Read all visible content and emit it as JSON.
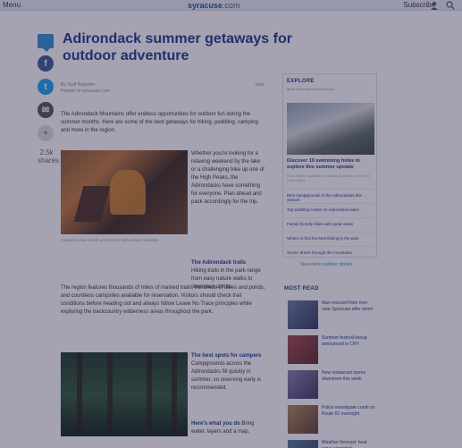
{
  "topbar": {
    "left": "Menu",
    "brand": "syracuse",
    "brand_suffix": ".com",
    "right": "Subscribe"
  },
  "share": {
    "count": "2.5k",
    "count_label": "shares"
  },
  "article": {
    "headline": "Adirondack summer getaways for outdoor adventure",
    "byline": "By Staff Reporter",
    "byline_sub": "Posted on syracuse.com",
    "date": "June",
    "lede": "The Adirondack Mountains offer endless opportunities for outdoor fun during the summer months. Here are some of the best getaways for hiking, paddling, camping and more in the region.",
    "caption1": "Campers relax inside a tent at an Adirondack campsite.",
    "side1": "Whether you're looking for a relaxing weekend by the lake or a challenging hike up one of the High Peaks, the Adirondacks have something for everyone. Plan ahead and pack accordingly for the trip.",
    "head_a": "The Adirondack trails",
    "side2": "Hiking trails in the park range from easy nature walks to strenuous climbs.",
    "full1": "The region features thousands of miles of marked trails, hundreds of lakes and ponds, and countless campsites available for reservation. Visitors should check trail conditions before heading out and always follow Leave No Trace principles while exploring the backcountry wilderness areas throughout the park.",
    "head_b": "The best spots for campers",
    "side3": "Campgrounds across the Adirondacks fill quickly in summer, so reserving early is recommended.",
    "head_c": "Here's what you do",
    "side4": "Bring water, layers and a map."
  },
  "sidebar": {
    "section_title": "EXPLORE",
    "section_sub": "More Adirondack travel stories",
    "feature_title": "Discover 10 swimming holes to explore this summer upstate",
    "feature_sub": "From hidden waterfalls to sandy beaches, cool off at these spots.",
    "links": [
      "Best campgrounds in the Adirondacks this season",
      "Top paddling routes on Adirondack lakes",
      "Family friendly hikes with great views",
      "Where to find the best fishing in the park",
      "Scenic drives through the mountains"
    ],
    "view_more": "View more outdoor stories"
  },
  "most_read": {
    "title": "MOST READ",
    "items": [
      "Man rescued from river near Syracuse after storm",
      "Summer festival lineup announced in CNY",
      "New restaurant opens downtown this week",
      "Police investigate crash on Route 81 overnight",
      "Weather forecast: heat wave expected"
    ]
  },
  "colors": {
    "accent": "#1e3a8a",
    "link": "#2f8fd8",
    "overlay": "#28224a"
  }
}
